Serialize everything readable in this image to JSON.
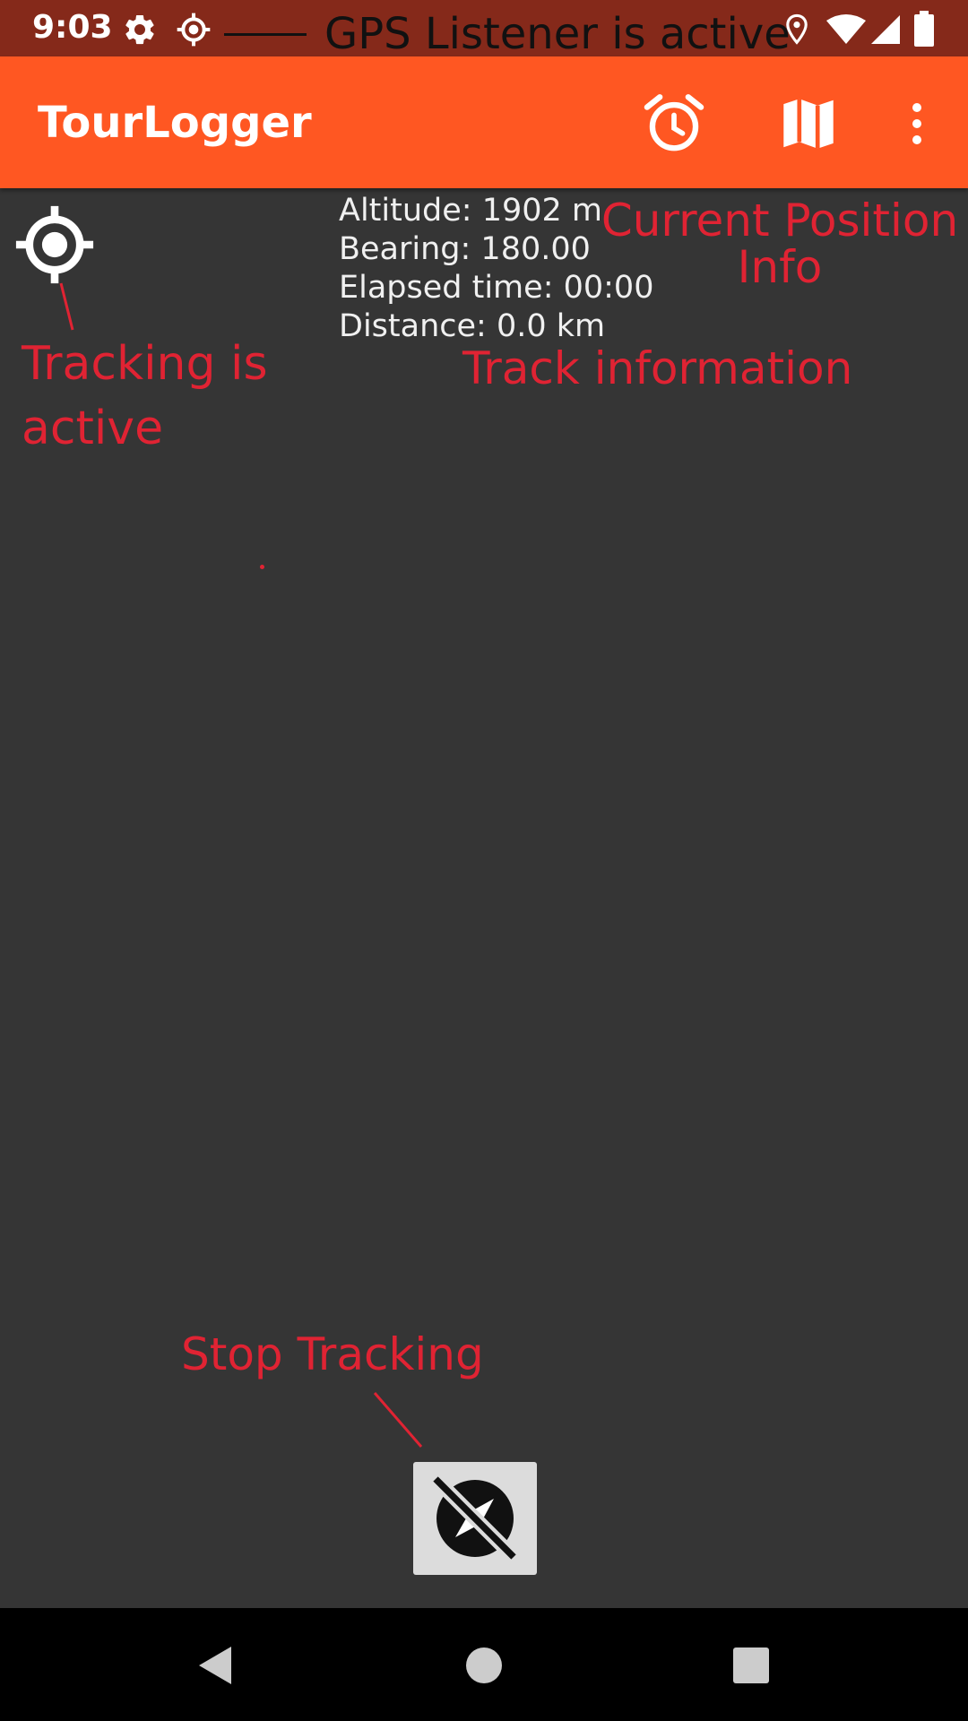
{
  "status_bar": {
    "time": "9:03",
    "icons": [
      "gear-icon",
      "gps-icon",
      "location-pin-icon",
      "wifi-icon",
      "signal-icon",
      "battery-icon"
    ]
  },
  "app_bar": {
    "title": "TourLogger",
    "actions": [
      "alarm-icon",
      "map-icon",
      "more-vert-icon"
    ]
  },
  "track_info": {
    "altitude": "Altitude: 1902 m",
    "bearing": "Bearing: 180.00",
    "elapsed": "Elapsed time: 00:00",
    "distance": "Distance: 0.0 km"
  },
  "annotations": {
    "gps_listener": "GPS Listener is active",
    "current_position_line1": "Current Position",
    "current_position_line2": "Info",
    "track_information": "Track information",
    "tracking_line1": "Tracking is",
    "tracking_line2": "active",
    "stop_tracking": "Stop Tracking"
  },
  "colors": {
    "status_bar": "#85291a",
    "app_bar": "#ff5722",
    "background": "#353535",
    "annotation": "#e02333",
    "stop_button": "#dcdcdc"
  },
  "buttons": {
    "stop_tracking_icon": "compass-off-icon"
  }
}
